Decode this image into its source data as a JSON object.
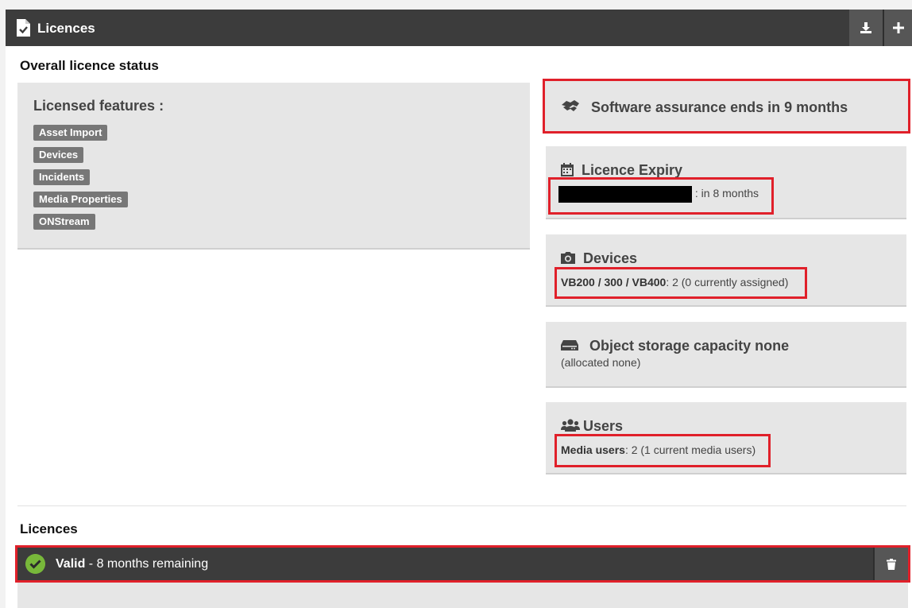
{
  "header": {
    "title": "Licences",
    "icons": {
      "title": "document-check-icon",
      "download": "download-icon",
      "add": "plus-icon"
    }
  },
  "overall": {
    "section_title": "Overall licence status",
    "features": {
      "heading": "Licensed features :",
      "items": [
        "Asset Import",
        "Devices",
        "Incidents",
        "Media Properties",
        "ONStream"
      ]
    }
  },
  "assurance": {
    "icon": "handshake-icon",
    "text": "Software assurance ends in 9 months"
  },
  "expiry": {
    "icon": "calendar-icon",
    "heading": "Licence Expiry",
    "suffix": ": in 8 months"
  },
  "devices": {
    "icon": "camera-icon",
    "heading": "Devices",
    "models": "VB200 / 300 / VB400",
    "detail": ": 2 (0 currently assigned)"
  },
  "storage": {
    "icon": "hard-drive-icon",
    "heading": "Object storage capacity none",
    "detail": "(allocated none)"
  },
  "users": {
    "icon": "users-icon",
    "heading": "Users",
    "label": "Media users",
    "detail": ": 2 (1 current media users)"
  },
  "licences": {
    "section_title": "Licences",
    "row": {
      "status": "Valid",
      "remaining": " - 8 months remaining",
      "icon": "check-circle-icon",
      "delete_icon": "trash-icon"
    }
  },
  "colors": {
    "header_bg": "#3c3c3c",
    "card_bg": "#e6e6e6",
    "highlight": "#e0202a",
    "tag_bg": "#777777",
    "valid_green": "#78b83a"
  }
}
